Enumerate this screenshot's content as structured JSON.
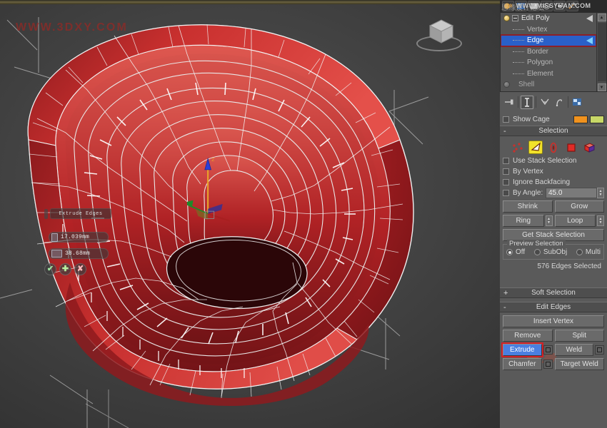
{
  "watermarks": {
    "viewport": "WWW.3DXY.COM",
    "panel": "WWW.MISSYUAN.COM",
    "panel_cn": "思缘设计论坛"
  },
  "viewport": {
    "name": "perspective-viewport",
    "viewcube_label": "viewcube",
    "caddy": {
      "title": "Extrude Edges",
      "height_value": "17.039mm",
      "width_value": "38.68mm",
      "height_icon": "extrude-height-icon",
      "width_icon": "extrude-base-width-icon",
      "ok_label": "✔",
      "apply_label": "✚",
      "cancel_label": "✘"
    },
    "gizmo": {
      "z_label": "Z"
    }
  },
  "panel": {
    "toolbar_icons": [
      "material-sphere-icon",
      "render-setup-icon",
      "render-frame-icon",
      "render-preview-icon",
      "render-last-icon",
      "utilities-hammer-icon"
    ],
    "stack": {
      "items": [
        {
          "label": "Edit Poly",
          "type": "modifier",
          "selected": false
        },
        {
          "label": "Vertex",
          "type": "subobject",
          "selected": false
        },
        {
          "label": "Edge",
          "type": "subobject",
          "selected": true
        },
        {
          "label": "Border",
          "type": "subobject",
          "selected": false
        },
        {
          "label": "Polygon",
          "type": "subobject",
          "selected": false
        },
        {
          "label": "Element",
          "type": "subobject",
          "selected": false
        },
        {
          "label": "Shell",
          "type": "modifier",
          "selected": false
        }
      ]
    },
    "tabs": [
      "pin-stack-icon",
      "show-end-result-icon",
      "make-unique-icon",
      "remove-modifier-icon",
      "configure-modifier-sets-icon"
    ],
    "show_cage": {
      "label": "Show Cage",
      "color1": "#f0921e",
      "color2": "#c8d867"
    },
    "selection": {
      "header": "Selection",
      "expanded_marker": "-",
      "subobject_icons": [
        "vertex-subobject-icon",
        "edge-subobject-icon",
        "border-subobject-icon",
        "polygon-subobject-icon",
        "element-subobject-icon"
      ],
      "active_subobject": "edge-subobject-icon",
      "use_stack_selection": "Use Stack Selection",
      "by_vertex": "By Vertex",
      "ignore_backfacing": "Ignore Backfacing",
      "by_angle_label": "By Angle:",
      "by_angle_value": "45.0",
      "shrink": "Shrink",
      "grow": "Grow",
      "ring": "Ring",
      "loop": "Loop",
      "get_stack_selection": "Get Stack Selection",
      "preview_group": "Preview Selection",
      "preview_options": [
        "Off",
        "SubObj",
        "Multi"
      ],
      "preview_selected": "Off",
      "status": "576 Edges Selected"
    },
    "soft_selection": {
      "header": "Soft Selection",
      "collapsed_marker": "+"
    },
    "edit_edges": {
      "header": "Edit Edges",
      "expanded_marker": "-",
      "insert_vertex": "Insert Vertex",
      "remove": "Remove",
      "split": "Split",
      "extrude": "Extrude",
      "weld": "Weld",
      "chamfer": "Chamfer",
      "target_weld": "Target Weld",
      "active_button": "Extrude"
    }
  },
  "colors": {
    "accent_selection_blue": "#2a60c8",
    "highlight_red": "#d12026",
    "model_red": "#b81f22",
    "caddy_yellow": "#f2e22a"
  }
}
